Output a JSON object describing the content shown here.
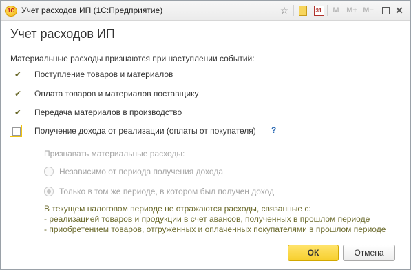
{
  "window": {
    "title": "Учет расходов ИП  (1С:Предприятие)",
    "logo_text": "1С",
    "toolbar": {
      "favorite": "☆",
      "calendar_day": "31",
      "mem": "M",
      "mem_plus": "M+",
      "mem_minus": "M−",
      "close": "✕"
    }
  },
  "form": {
    "heading": "Учет расходов ИП",
    "intro": "Материальные расходы признаются при наступлении событий:",
    "checked_events": [
      {
        "label": "Поступление товаров и материалов"
      },
      {
        "label": "Оплата товаров и материалов поставщику"
      },
      {
        "label": "Передача материалов в производство"
      }
    ],
    "income_checkbox": {
      "label": "Получение дохода от реализации (оплаты от покупателя)",
      "checked": false,
      "help": "?"
    },
    "recognize_label": "Признавать материальные расходы:",
    "radio_options": [
      {
        "label": "Независимо от периода получения дохода",
        "selected": false
      },
      {
        "label": "Только в том же периоде, в котором был получен доход",
        "selected": true
      }
    ],
    "note_lines": [
      "В текущем налоговом периоде не отражаются расходы, связанные с:",
      "- реализацией товаров и продукции в счет авансов, полученных в прошлом периоде",
      "- приобретением товаров, отгруженных и оплаченных покупателями в прошлом периоде"
    ]
  },
  "buttons": {
    "ok": "ОК",
    "cancel": "Отмена"
  }
}
